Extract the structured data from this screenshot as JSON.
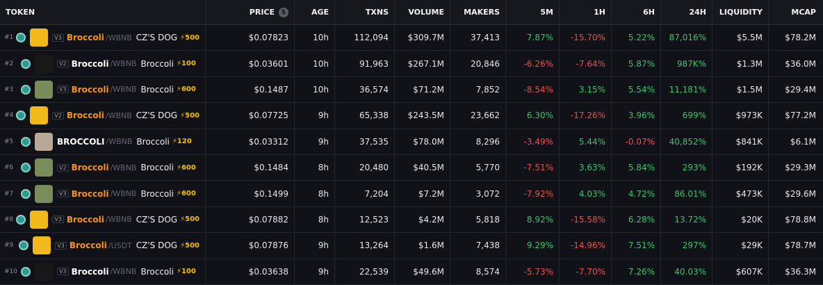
{
  "headers": {
    "token": "TOKEN",
    "price": "PRICE",
    "price_icon": "$",
    "age": "AGE",
    "txns": "TXNS",
    "volume": "VOLUME",
    "makers": "MAKERS",
    "m5": "5M",
    "h1": "1H",
    "h6": "6H",
    "h24": "24H",
    "liquidity": "LIQUIDITY",
    "mcap": "MCAP"
  },
  "rows": [
    {
      "rank": "#1",
      "version": "V3",
      "base": "Broccoli",
      "quote": "/WBNB",
      "pair_name": "CZ'S DOG",
      "boost": "⚡500",
      "avatar": "dog",
      "price": "$0.07823",
      "age": "10h",
      "txns": "112,094",
      "volume": "$309.7M",
      "makers": "37,413",
      "m5": "7.87%",
      "m5_dir": "pos",
      "h1": "-15.70%",
      "h1_dir": "neg",
      "h6": "5.22%",
      "h6_dir": "pos",
      "h24": "87,016%",
      "h24_dir": "pos",
      "liquidity": "$5.5M",
      "mcap": "$78.2M"
    },
    {
      "rank": "#2",
      "version": "V2",
      "base": "Broccoli",
      "quote": "/WBNB",
      "pair_name": "Broccoli",
      "boost": "⚡100",
      "avatar": "brocc-dark",
      "price": "$0.03601",
      "age": "10h",
      "txns": "91,963",
      "volume": "$267.1M",
      "makers": "20,846",
      "m5": "-6.26%",
      "m5_dir": "neg",
      "h1": "-7.64%",
      "h1_dir": "neg",
      "h6": "5.87%",
      "h6_dir": "pos",
      "h24": "987K%",
      "h24_dir": "pos",
      "liquidity": "$1.3M",
      "mcap": "$36.0M",
      "base_white": true
    },
    {
      "rank": "#3",
      "version": "V3",
      "base": "Broccoli",
      "quote": "/WBNB",
      "pair_name": "Broccoli",
      "boost": "⚡600",
      "avatar": "frog",
      "price": "$0.1487",
      "age": "10h",
      "txns": "36,574",
      "volume": "$71.2M",
      "makers": "7,852",
      "m5": "-8.54%",
      "m5_dir": "neg",
      "h1": "3.15%",
      "h1_dir": "pos",
      "h6": "5.54%",
      "h6_dir": "pos",
      "h24": "11,181%",
      "h24_dir": "pos",
      "liquidity": "$1.5M",
      "mcap": "$29.4M"
    },
    {
      "rank": "#4",
      "version": "V2",
      "base": "Broccoli",
      "quote": "/WBNB",
      "pair_name": "CZ'S DOG",
      "boost": "⚡500",
      "avatar": "dog",
      "price": "$0.07725",
      "age": "9h",
      "txns": "65,338",
      "volume": "$243.5M",
      "makers": "23,662",
      "m5": "6.30%",
      "m5_dir": "pos",
      "h1": "-17.26%",
      "h1_dir": "neg",
      "h6": "3.96%",
      "h6_dir": "pos",
      "h24": "699%",
      "h24_dir": "pos",
      "liquidity": "$973K",
      "mcap": "$77.2M"
    },
    {
      "rank": "#5",
      "version": "",
      "base": "BROCCOLI",
      "quote": "/WBNB",
      "pair_name": "Broccoli",
      "boost": "⚡120",
      "avatar": "ape",
      "price": "$0.03312",
      "age": "9h",
      "txns": "37,535",
      "volume": "$78.0M",
      "makers": "8,296",
      "m5": "-3.49%",
      "m5_dir": "neg",
      "h1": "5.44%",
      "h1_dir": "pos",
      "h6": "-0.07%",
      "h6_dir": "neg",
      "h24": "40,852%",
      "h24_dir": "pos",
      "liquidity": "$841K",
      "mcap": "$6.1M",
      "base_white": true
    },
    {
      "rank": "#6",
      "version": "V2",
      "base": "Broccoli",
      "quote": "/WBNB",
      "pair_name": "Broccoli",
      "boost": "⚡600",
      "avatar": "frog",
      "price": "$0.1484",
      "age": "8h",
      "txns": "20,480",
      "volume": "$40.5M",
      "makers": "5,770",
      "m5": "-7.51%",
      "m5_dir": "neg",
      "h1": "3.63%",
      "h1_dir": "pos",
      "h6": "5.84%",
      "h6_dir": "pos",
      "h24": "293%",
      "h24_dir": "pos",
      "liquidity": "$192K",
      "mcap": "$29.3M"
    },
    {
      "rank": "#7",
      "version": "V3",
      "base": "Broccoli",
      "quote": "/WBNB",
      "pair_name": "Broccoli",
      "boost": "⚡600",
      "avatar": "frog",
      "price": "$0.1499",
      "age": "8h",
      "txns": "7,204",
      "volume": "$7.2M",
      "makers": "3,072",
      "m5": "-7.92%",
      "m5_dir": "neg",
      "h1": "4.03%",
      "h1_dir": "pos",
      "h6": "4.72%",
      "h6_dir": "pos",
      "h24": "86.01%",
      "h24_dir": "pos",
      "liquidity": "$473K",
      "mcap": "$29.6M"
    },
    {
      "rank": "#8",
      "version": "V3",
      "base": "Broccoli",
      "quote": "/WBNB",
      "pair_name": "CZ'S DOG",
      "boost": "⚡500",
      "avatar": "dog",
      "price": "$0.07882",
      "age": "8h",
      "txns": "12,523",
      "volume": "$4.2M",
      "makers": "5,818",
      "m5": "8.92%",
      "m5_dir": "pos",
      "h1": "-15.58%",
      "h1_dir": "neg",
      "h6": "6.28%",
      "h6_dir": "pos",
      "h24": "13.72%",
      "h24_dir": "pos",
      "liquidity": "$20K",
      "mcap": "$78.8M"
    },
    {
      "rank": "#9",
      "version": "V3",
      "base": "Broccoli",
      "quote": "/USDT",
      "pair_name": "CZ'S DOG",
      "boost": "⚡500",
      "avatar": "dog",
      "price": "$0.07876",
      "age": "9h",
      "txns": "13,264",
      "volume": "$1.6M",
      "makers": "7,438",
      "m5": "9.29%",
      "m5_dir": "pos",
      "h1": "-14.96%",
      "h1_dir": "neg",
      "h6": "7.51%",
      "h6_dir": "pos",
      "h24": "297%",
      "h24_dir": "pos",
      "liquidity": "$29K",
      "mcap": "$78.7M"
    },
    {
      "rank": "#10",
      "version": "V3",
      "base": "Broccoli",
      "quote": "/WBNB",
      "pair_name": "Broccoli",
      "boost": "⚡100",
      "avatar": "brocc-dark",
      "price": "$0.03638",
      "age": "9h",
      "txns": "22,539",
      "volume": "$49.6M",
      "makers": "8,574",
      "m5": "-5.73%",
      "m5_dir": "neg",
      "h1": "-7.70%",
      "h1_dir": "neg",
      "h6": "7.26%",
      "h6_dir": "pos",
      "h24": "40.03%",
      "h24_dir": "pos",
      "liquidity": "$607K",
      "mcap": "$36.3M",
      "base_white": true
    }
  ]
}
